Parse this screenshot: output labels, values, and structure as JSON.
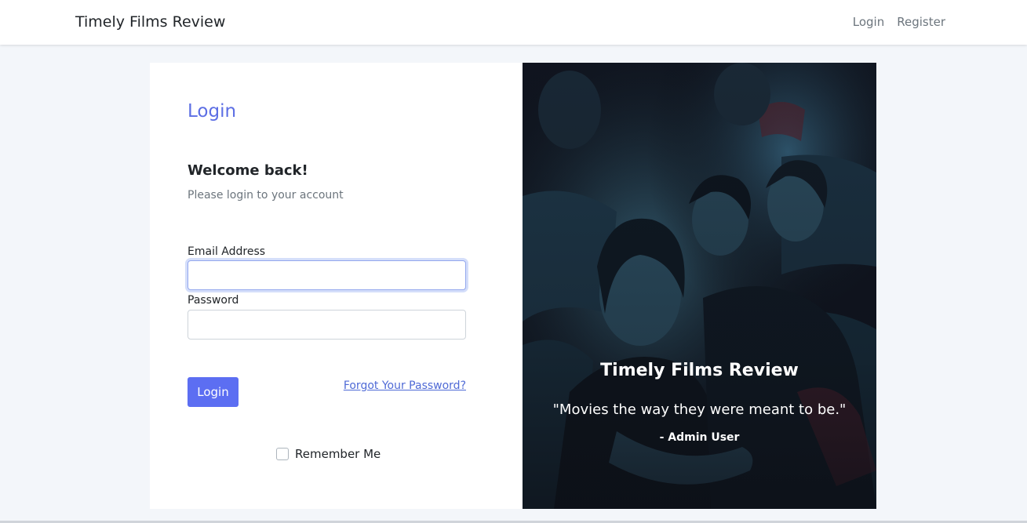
{
  "navbar": {
    "brand": "Timely Films Review",
    "links": [
      {
        "label": "Login"
      },
      {
        "label": "Register"
      }
    ]
  },
  "login_form": {
    "title": "Login",
    "welcome": "Welcome back!",
    "subtitle": "Please login to your account",
    "email": {
      "label": "Email Address",
      "value": "",
      "placeholder": ""
    },
    "password": {
      "label": "Password",
      "value": "",
      "placeholder": ""
    },
    "submit_label": "Login",
    "forgot_label": "Forgot Your Password?",
    "remember_label": "Remember Me",
    "remember_checked": false
  },
  "hero": {
    "title": "Timely Films Review",
    "quote": "\"Movies the way they were meant to be.\"",
    "author": "- Admin User",
    "image_subject": "cinema-audience-illustration"
  },
  "colors": {
    "accent": "#5c6ef2",
    "title": "#5c6ee4",
    "link": "#4f6ad6",
    "page_bg": "#f3f6fa",
    "hero_bg": "#0c0f16"
  }
}
